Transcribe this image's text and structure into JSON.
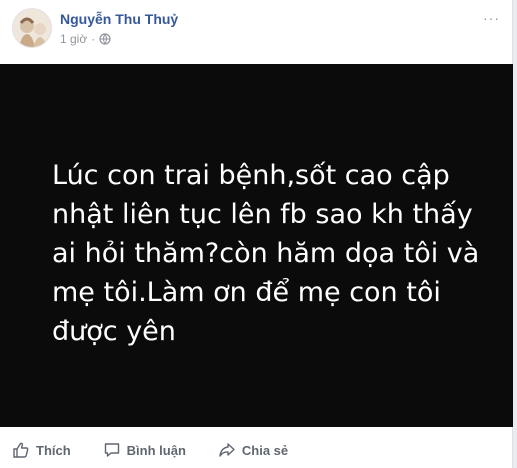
{
  "post": {
    "author": "Nguyễn Thu Thuỷ",
    "time": "1 giờ",
    "separator": "·",
    "more": "···",
    "body_text": "Lúc con trai bệnh,sốt cao cập nhật liên tục lên fb sao kh thấy ai hỏi thăm?còn hăm dọa tôi và mẹ tôi.Làm ơn để mẹ con tôi được yên",
    "background_color": "#0b0b0b",
    "text_color": "#ffffff"
  },
  "actions": {
    "like_label": "Thích",
    "comment_label": "Bình luận",
    "share_label": "Chia sẻ"
  },
  "icons": {
    "avatar": "profile-photo",
    "audience": "globe-icon",
    "menu": "more-options-icon",
    "like": "thumbs-up-icon",
    "comment": "comment-bubble-icon",
    "share": "share-arrow-icon"
  },
  "colors": {
    "author_link": "#365899",
    "meta_gray": "#90949c",
    "action_gray": "#606770"
  }
}
